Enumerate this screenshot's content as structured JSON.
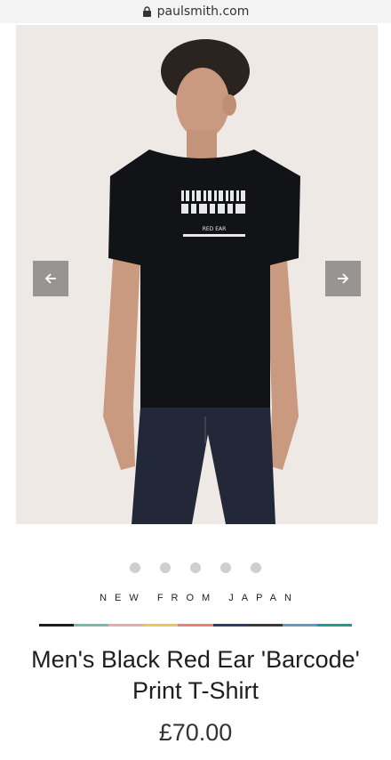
{
  "browser": {
    "url": "paulsmith.com",
    "lock_icon": "lock-icon"
  },
  "product": {
    "image_alt": "Men's Black Red Ear 'Barcode' Print T-Shirt on model",
    "print_text": "RED EAR",
    "gallery": {
      "prev_icon": "arrow-left-icon",
      "next_icon": "arrow-right-icon",
      "dot_count": 5
    },
    "tagline": "NEW FROM JAPAN",
    "title_line1": "Men's Black Red Ear 'Barcode'",
    "title_line2": "Print T-Shirt",
    "price": "£70.00"
  },
  "colors": {
    "hero_bg": "#efe9e6",
    "stripe": [
      "#1d1d1d",
      "#7fb7a9",
      "#f0a6a6",
      "#f2c25b",
      "#e9807a",
      "#2c3e66",
      "#3a3a3a",
      "#5a9cc9",
      "#1f9a8c"
    ]
  }
}
